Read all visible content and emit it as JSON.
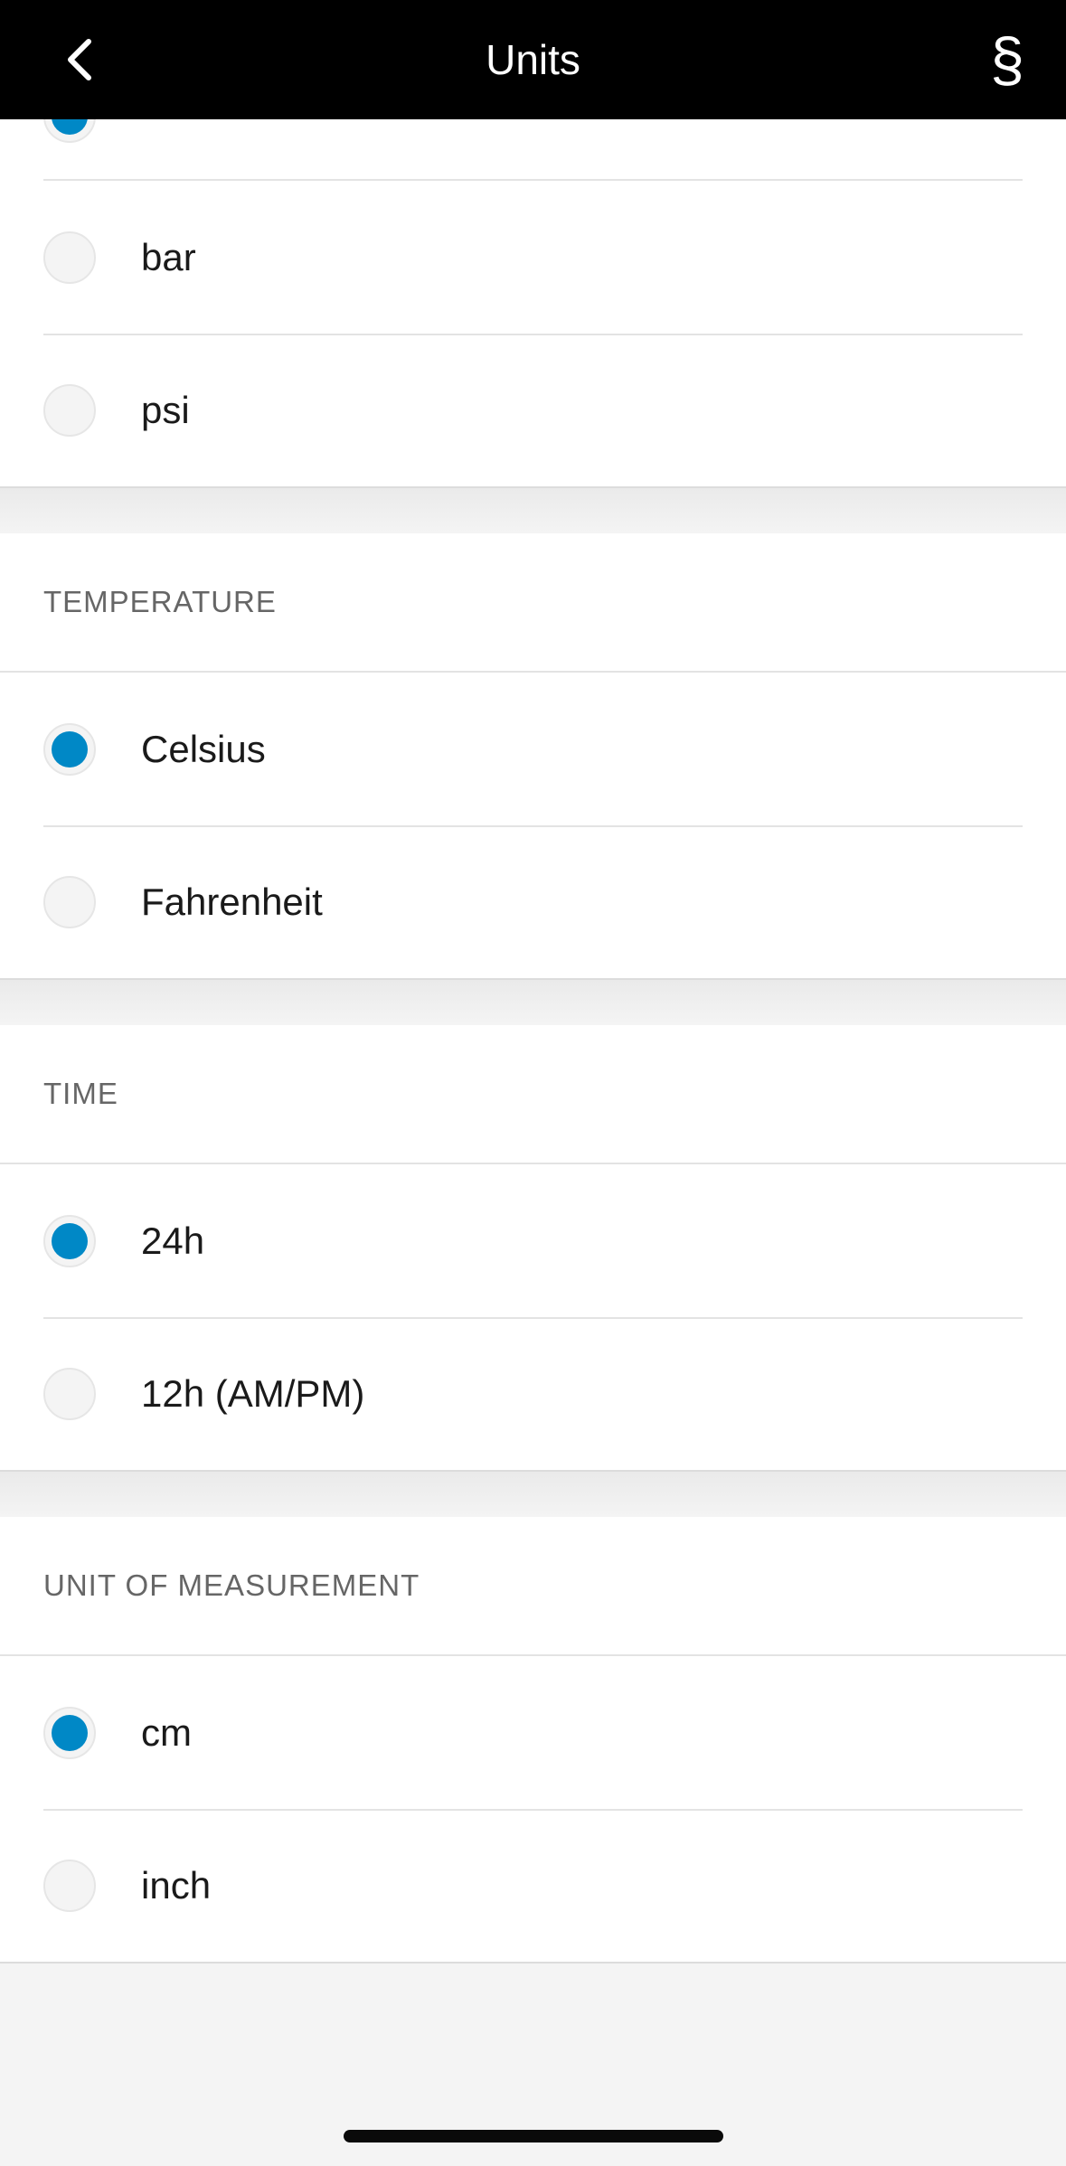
{
  "header": {
    "title": "Units",
    "back_icon": "chevron-left-icon",
    "legal_symbol": "§"
  },
  "pressure": {
    "options": [
      {
        "label": "",
        "selected": true
      },
      {
        "label": "bar",
        "selected": false
      },
      {
        "label": "psi",
        "selected": false
      }
    ]
  },
  "temperature": {
    "heading": "TEMPERATURE",
    "options": [
      {
        "label": "Celsius",
        "selected": true
      },
      {
        "label": "Fahrenheit",
        "selected": false
      }
    ]
  },
  "time": {
    "heading": "TIME",
    "options": [
      {
        "label": "24h",
        "selected": true
      },
      {
        "label": "12h (AM/PM)",
        "selected": false
      }
    ]
  },
  "measurement": {
    "heading": "UNIT OF MEASUREMENT",
    "options": [
      {
        "label": "cm",
        "selected": true
      },
      {
        "label": "inch",
        "selected": false
      }
    ]
  },
  "colors": {
    "accent": "#0088c6",
    "header_bg": "#000000"
  }
}
